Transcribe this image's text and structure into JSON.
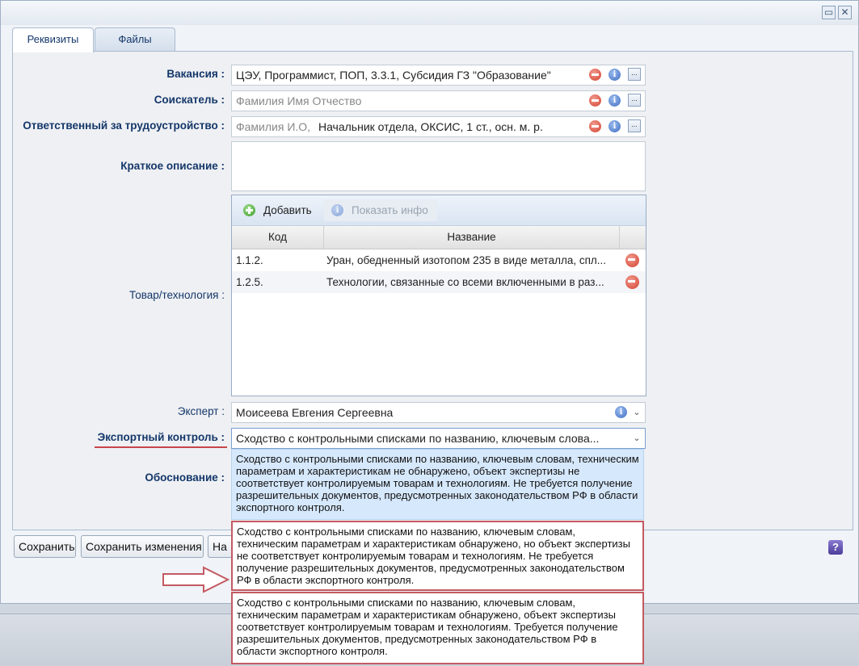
{
  "tabs": [
    {
      "label": "Реквизиты",
      "active": true
    },
    {
      "label": "Файлы",
      "active": false
    }
  ],
  "window_controls": {
    "restore_icon": "restore-icon",
    "close_icon": "close-icon"
  },
  "form": {
    "vacancy": {
      "label": "Вакансия :",
      "value": "ЦЭУ, Программист, ПОП, 3.3.1, Субсидия ГЗ \"Образование\""
    },
    "applicant": {
      "label": "Соискатель :",
      "placeholder": "Фамилия Имя Отчество"
    },
    "responsible": {
      "label": "Ответственный за трудоустройство :",
      "placeholder": "Фамилия И.О,",
      "value": "Начальник отдела, ОКСИС, 1 ст., осн. м. р."
    },
    "short_description": {
      "label": "Краткое описание :",
      "value": ""
    },
    "goods": {
      "label": "Товар/технология :",
      "toolbar": {
        "add": "Добавить",
        "show_info": "Показать инфо"
      },
      "columns": [
        "Код",
        "Название"
      ],
      "rows": [
        {
          "code": "1.1.2.",
          "name": "Уран, обедненный изотопом 235 в виде металла, спл..."
        },
        {
          "code": "1.2.5.",
          "name": "Технологии, связанные со всеми включенными в раз..."
        }
      ]
    },
    "expert": {
      "label": "Эксперт :",
      "value": "Моисеева Евгения Сергеевна"
    },
    "export_control": {
      "label": "Экспортный контроль :",
      "value": "Сходство с контрольными списками по названию, ключевым слова..."
    },
    "justification": {
      "label": "Обоснование :"
    }
  },
  "dropdown_options": [
    "Сходство с контрольными списками по названию, ключевым словам, техническим параметрам и характеристикам не обнаружено, объект экспертизы не соответствует контролируемым товарам и технологиям. Не требуется получение разрешительных документов, предусмотренных законодательством РФ в области экспортного контроля.",
    "Сходство с контрольными списками по названию, ключевым словам, техническим параметрам и характеристикам обнаружено, но объект экспертизы не соответствует контролируемым товарам и технологиям. Не требуется получение разрешительных документов, предусмотренных законодательством РФ в области экспортного контроля.",
    "Сходство с контрольными списками по названию, ключевым словам, техническим параметрам и характеристикам обнаружено, объект экспертизы соответствует контролируемым товарам и технологиям. Требуется получение разрешительных документов, предусмотренных законодательством РФ в области экспортного контроля."
  ],
  "buttons": {
    "save": "Сохранить",
    "save_changes": "Сохранить изменения",
    "third": "На"
  },
  "colors": {
    "label_blue": "#15376a",
    "highlight_red": "#c35a62",
    "selected_option": "#d6e8fc"
  }
}
